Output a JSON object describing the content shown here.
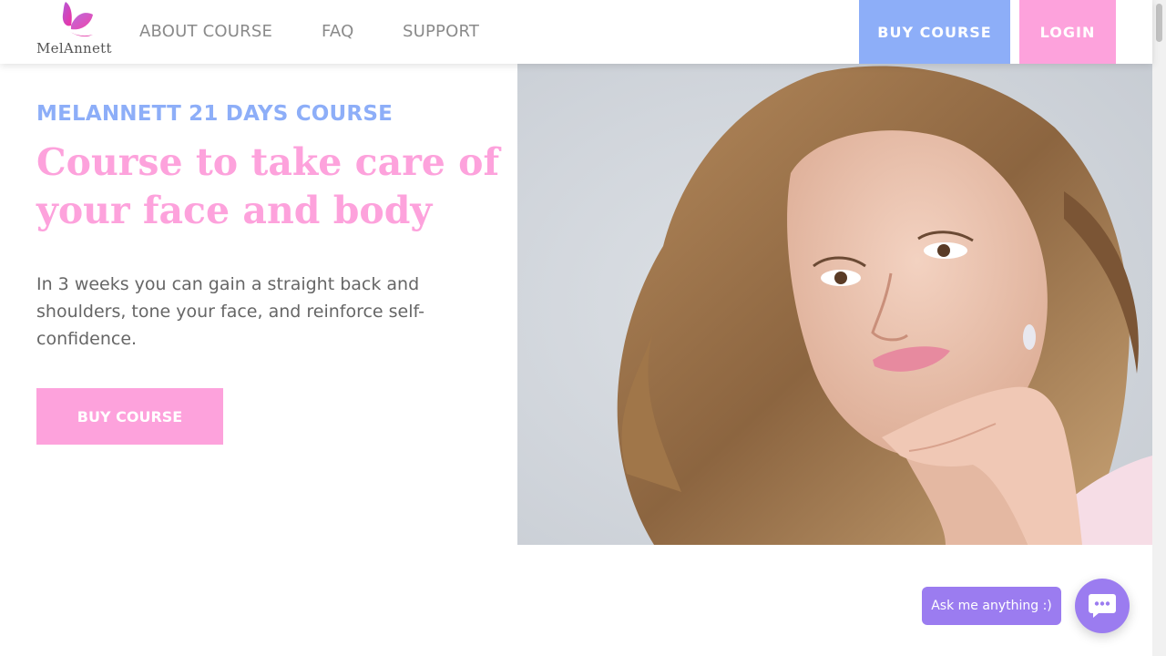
{
  "brand": {
    "name": "MelAnnett"
  },
  "nav": {
    "links": [
      "ABOUT COURSE",
      "FAQ",
      "SUPPORT"
    ],
    "buy_label": "BUY COURSE",
    "login_label": "LOGIN"
  },
  "hero": {
    "eyebrow": "MELANNETT 21 DAYS COURSE",
    "title": "Course to take care of your face and body",
    "description": "In 3 weeks you can gain a straight back and shoulders, tone your face, and reinforce self-confidence.",
    "cta_label": "BUY COURSE"
  },
  "chat": {
    "prompt": "Ask me anything :)",
    "icon": "chat-icon"
  },
  "colors": {
    "blue": "#8daef8",
    "pink": "#fda2dc",
    "purple": "#9b7cf0",
    "text_gray": "#666666"
  }
}
